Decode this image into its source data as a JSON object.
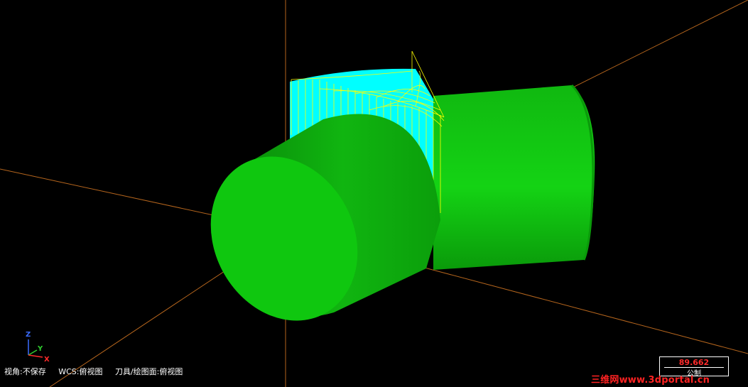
{
  "status_bar": {
    "view_angle": "视角:不保存",
    "wcs": "WCS:俯视图",
    "tool_plane": "刀具/绘图面:俯视图"
  },
  "triad": {
    "z": "Z",
    "y": "Y",
    "x": "X"
  },
  "scale": {
    "value": "89.662",
    "unit": "公制"
  },
  "watermark": "三维网www.3dportal.cn",
  "colors": {
    "background": "#000000",
    "axis_lines": "#b5651d",
    "solid": "#0fc70f",
    "surface": "#00ffff",
    "toolpath": "#ffff00"
  }
}
